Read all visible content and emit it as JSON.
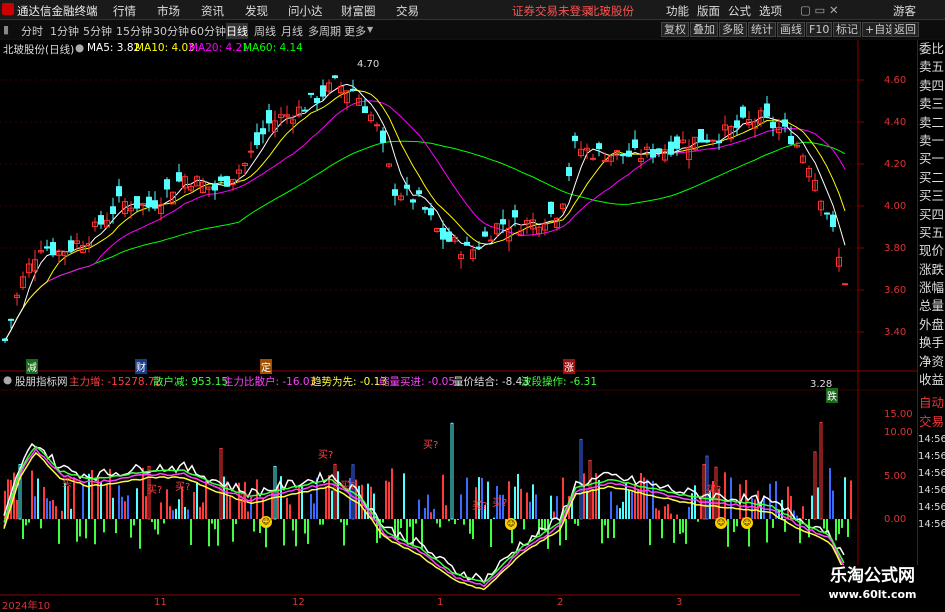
{
  "menubar": {
    "app_title": "通达信金融终端",
    "items": [
      "行情",
      "市场",
      "资讯",
      "发现",
      "问小达",
      "财富圈",
      "交易"
    ],
    "notice": "证券交易未登录",
    "stock_name": "北玻股份",
    "right_items": [
      "功能",
      "版面",
      "公式",
      "选项"
    ],
    "guest": "游客"
  },
  "toolbar": {
    "periods": [
      "分时",
      "1分钟",
      "5分钟",
      "15分钟",
      "30分钟",
      "60分钟",
      "日线",
      "周线",
      "月线",
      "多周期",
      "更多"
    ],
    "active_period": "日线",
    "right_buttons": [
      "复权",
      "叠加",
      "多股",
      "统计",
      "画线",
      "F10",
      "标记",
      "+自选",
      "返回"
    ]
  },
  "main_legend": {
    "title": "北玻股份(日线)",
    "ma5": "MA5: 3.82",
    "ma10": "MA10: 4.03",
    "ma20": "MA20: 4.21",
    "ma60": "MA60: 4.14"
  },
  "price_axis": [
    "4.60",
    "4.40",
    "4.20",
    "4.00",
    "3.80",
    "3.60",
    "3.40"
  ],
  "annotations": {
    "high": "4.70",
    "low": "3.28",
    "markers": [
      "减",
      "财",
      "定",
      "涨",
      "跌"
    ]
  },
  "indicator_legend": {
    "title": "股朋指标网",
    "items": [
      {
        "label": "主力增: -15278.72",
        "color": "#ff4040"
      },
      {
        "label": "散户减: 953.15",
        "color": "#40ff40"
      },
      {
        "label": "主力比散户: -16.03",
        "color": "#ff40ff"
      },
      {
        "label": "趋势为先: -0.13",
        "color": "#ffff40"
      },
      {
        "label": "缩量买进: -0.05",
        "color": "#ff40ff"
      },
      {
        "label": "量价结合: -8.43",
        "color": "#dddddd"
      },
      {
        "label": "波段操作: -6.31",
        "color": "#40ff40"
      }
    ],
    "buy_signal": "买?"
  },
  "indicator_axis": [
    "15.00",
    "10.00",
    "5.00",
    "0.00"
  ],
  "date_axis": [
    "2024年10",
    "11",
    "12",
    "1",
    "2",
    "3"
  ],
  "right_panel": {
    "items": [
      "委比",
      "卖五",
      "卖四",
      "卖三",
      "卖二",
      "卖一",
      "买一",
      "买二",
      "买三",
      "买四",
      "买五",
      "现价",
      "涨跌",
      "涨幅",
      "总量",
      "外盘",
      "换手",
      "净资",
      "收益",
      "自动",
      "交易"
    ],
    "times": [
      "14:56",
      "14:56",
      "14:56",
      "14:56",
      "14:56",
      "14:56",
      "14:56",
      "14:56"
    ]
  },
  "watermark": {
    "line1": "乐淘公式网",
    "line2": "www.60lt.com"
  },
  "colors": {
    "up": "#ff3232",
    "down": "#54ffff",
    "ma5": "#ffffff",
    "ma10": "#ffff00",
    "ma20": "#ff00ff",
    "ma60": "#00ff00"
  }
}
